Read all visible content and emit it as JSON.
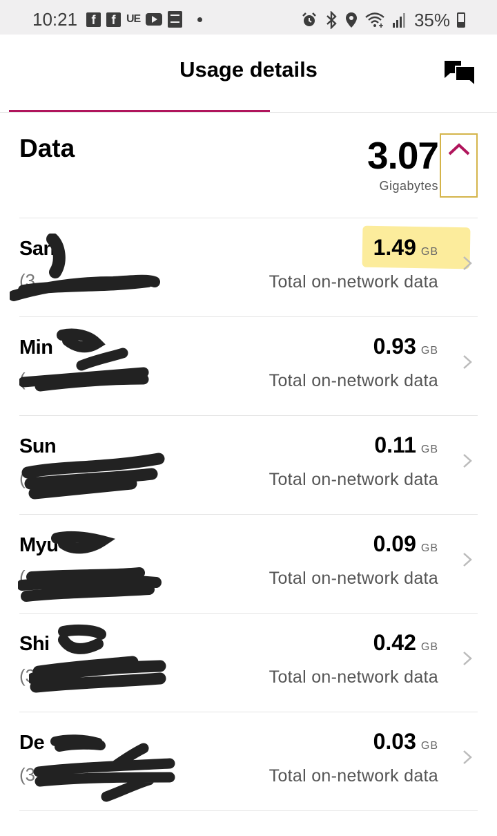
{
  "status_bar": {
    "time": "10:21",
    "facebook_glyph": "f",
    "ue_label": "UE",
    "battery_pct": "35%"
  },
  "header": {
    "title": "Usage details"
  },
  "summary": {
    "title": "Data",
    "value": "3.07",
    "unit": "Gigabytes"
  },
  "lines": [
    {
      "name": "San",
      "phone": "(3",
      "value": "1.49",
      "unit": "GB",
      "desc": "Total on-network data"
    },
    {
      "name": "Min",
      "phone": "(",
      "value": "0.93",
      "unit": "GB",
      "desc": "Total on-network data"
    },
    {
      "name": "Sun",
      "phone": "(",
      "value": "0.11",
      "unit": "GB",
      "desc": "Total on-network data"
    },
    {
      "name": "Myu",
      "phone": "(",
      "value": "0.09",
      "unit": "GB",
      "desc": "Total on-network data"
    },
    {
      "name": "Shi",
      "phone": "(3",
      "value": "0.42",
      "unit": "GB",
      "desc": "Total on-network data"
    },
    {
      "name": "De",
      "phone": "(3",
      "value": "0.03",
      "unit": "GB",
      "desc": "Total on-network data"
    }
  ],
  "colors": {
    "accent": "#b0155c",
    "highlight": "#fbe98b",
    "outline": "#d4b44a"
  },
  "icons": [
    "facebook-icon",
    "youtube-icon",
    "bible-icon",
    "alarm-icon",
    "bluetooth-icon",
    "location-icon",
    "wifi-icon",
    "signal-icon",
    "battery-icon",
    "chat-icon",
    "chevron-up-icon",
    "chevron-right-icon"
  ]
}
